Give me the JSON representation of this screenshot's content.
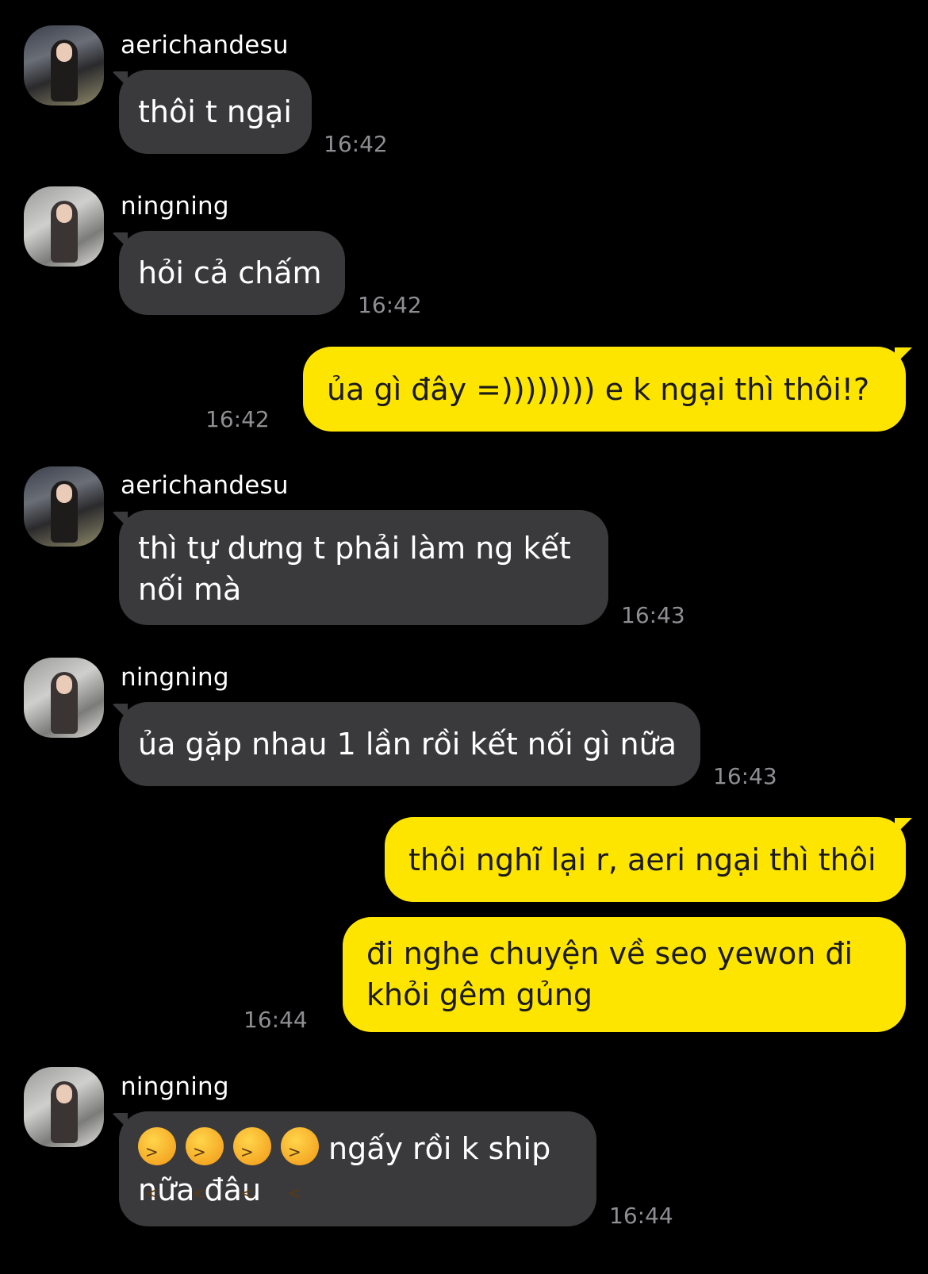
{
  "messages": [
    {
      "sender": "aerichandesu",
      "text": "thôi t ngại",
      "time": "16:42"
    },
    {
      "sender": "ningning",
      "text": "hỏi cả chấm",
      "time": "16:42"
    },
    {
      "text": "ủa gì đây =)))))))) e k ngại thì thôi!?",
      "time": "16:42"
    },
    {
      "sender": "aerichandesu",
      "line1": "thì tự dưng t phải làm ng kết",
      "line2": "nối mà",
      "time": "16:43"
    },
    {
      "sender": "ningning",
      "text": "ủa gặp nhau 1 lần rồi kết nối gì nữa",
      "time": "16:43"
    },
    {
      "text": "thôi nghĩ lại r, aeri ngại thì thôi"
    },
    {
      "line1": "đi nghe chuyện về seo yewon đi",
      "line2": "khỏi gêm gủng",
      "time": "16:44"
    },
    {
      "sender": "ningning",
      "emoji": "tired-face-emoji",
      "emoji_count": 4,
      "line1": "ngấy rồi k ship",
      "line2": "nữa đâu",
      "time": "16:44"
    }
  ],
  "colors": {
    "incoming": "#3a3a3c",
    "outgoing": "#fee500",
    "background": "#000000",
    "timestamp": "#8e8e93"
  }
}
